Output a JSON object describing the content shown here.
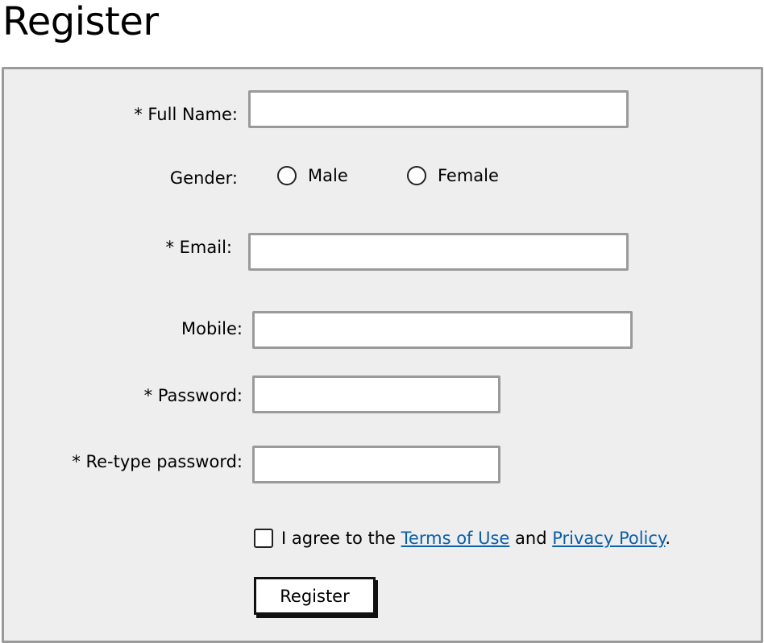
{
  "page": {
    "title": "Register"
  },
  "form": {
    "full_name": {
      "label": "* Full Name:",
      "value": ""
    },
    "gender": {
      "label": "Gender:",
      "options": [
        {
          "label": "Male",
          "selected": false
        },
        {
          "label": "Female",
          "selected": false
        }
      ]
    },
    "email": {
      "label": "* Email:",
      "value": ""
    },
    "mobile": {
      "label": "Mobile:",
      "value": ""
    },
    "password": {
      "label": "* Password:",
      "value": ""
    },
    "retype_password": {
      "label": "* Re-type password:",
      "value": ""
    },
    "agree": {
      "checked": false,
      "prefix": "I agree to the",
      "terms_link": "Terms of Use",
      "middle": "and",
      "privacy_link": "Privacy Policy",
      "suffix": "."
    },
    "submit_label": "Register"
  },
  "colors": {
    "panel_background": "#eeeeee",
    "border": "#9a9a9a",
    "link": "#0b5ea8"
  }
}
